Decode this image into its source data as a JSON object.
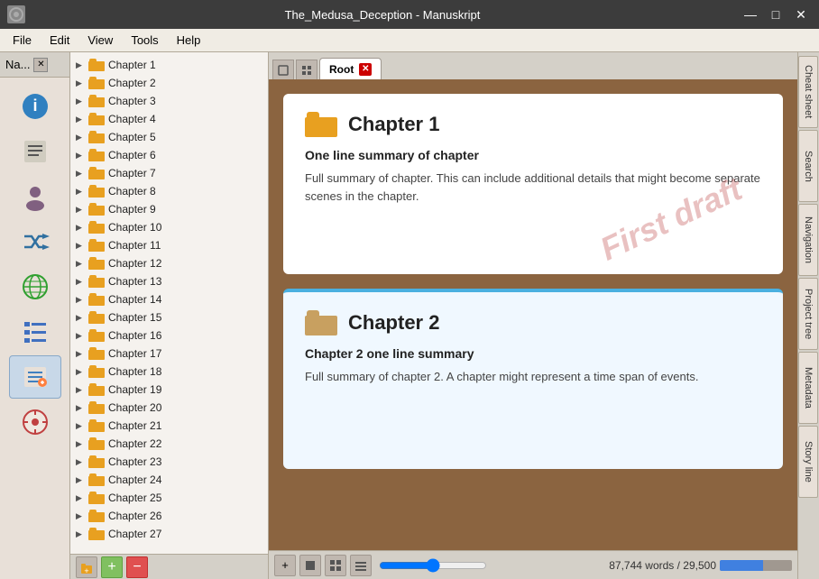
{
  "titlebar": {
    "title": "The_Medusa_Deception - Manuskript",
    "icon": "◎",
    "minimize": "—",
    "maximize": "□",
    "close": "✕"
  },
  "menubar": {
    "items": [
      "File",
      "Edit",
      "View",
      "Tools",
      "Help"
    ]
  },
  "sidebar": {
    "header": "Na...",
    "icons": [
      {
        "name": "info-icon",
        "symbol": "ℹ",
        "color": "#3080c0"
      },
      {
        "name": "notes-icon",
        "symbol": "≡",
        "color": "#808080"
      },
      {
        "name": "character-icon",
        "symbol": "👤",
        "color": "#806080"
      },
      {
        "name": "shuffle-icon",
        "symbol": "⇌",
        "color": "#3070a0"
      },
      {
        "name": "globe-icon",
        "symbol": "🌐",
        "color": "#30a030"
      },
      {
        "name": "list-icon",
        "symbol": "☰",
        "color": "#4070c0"
      },
      {
        "name": "edit-list-icon",
        "symbol": "📝",
        "color": "#4080c0"
      },
      {
        "name": "compass-icon",
        "symbol": "⊕",
        "color": "#c04040"
      }
    ]
  },
  "chapters": [
    "Chapter 1",
    "Chapter 2",
    "Chapter 3",
    "Chapter 4",
    "Chapter 5",
    "Chapter 6",
    "Chapter 7",
    "Chapter 8",
    "Chapter 9",
    "Chapter 10",
    "Chapter 11",
    "Chapter 12",
    "Chapter 13",
    "Chapter 14",
    "Chapter 15",
    "Chapter 16",
    "Chapter 17",
    "Chapter 18",
    "Chapter 19",
    "Chapter 20",
    "Chapter 21",
    "Chapter 22",
    "Chapter 23",
    "Chapter 24",
    "Chapter 25",
    "Chapter 26",
    "Chapter 27"
  ],
  "tabs": [
    {
      "label": "Root",
      "active": true
    }
  ],
  "chapter_cards": [
    {
      "title": "Chapter 1",
      "one_line": "One line summary of chapter",
      "description": "Full summary of chapter.  This can include additional details that might become separate scenes in the chapter.",
      "watermark": "First draft"
    },
    {
      "title": "Chapter 2",
      "one_line": "Chapter 2 one line summary",
      "description": "Full summary of chapter 2.  A chapter might represent a time span of events.",
      "watermark": ""
    }
  ],
  "right_tabs": [
    "Cheat sheet",
    "Search",
    "Navigation",
    "Project tree",
    "Metadata",
    "Story line"
  ],
  "bottom_toolbar": {
    "word_count": "87,744 words / 29,500",
    "add_label": "+",
    "remove_label": "−",
    "progress_pct": 60
  }
}
